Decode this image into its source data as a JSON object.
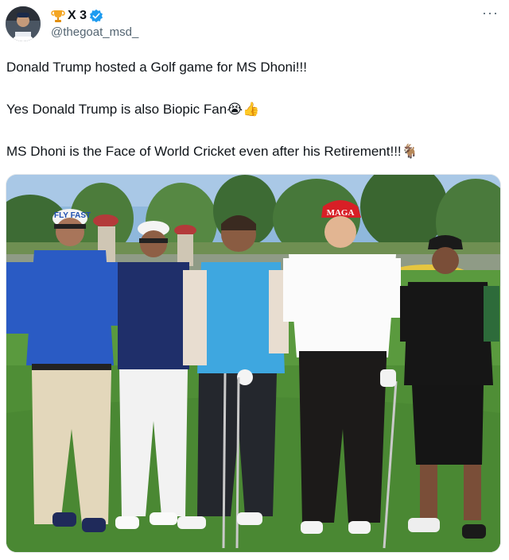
{
  "post": {
    "author": {
      "name_prefix_icon": "trophy-icon",
      "name": "X 3",
      "handle": "@thegoat_msd_",
      "verified_color": "#1d9bf0",
      "avatar_icon": "person-avatar"
    },
    "more_icon": "ellipsis-icon",
    "lines": [
      {
        "text": "Donald Trump hosted a Golf game for MS Dhoni!!!",
        "emoji": ""
      },
      {
        "text": "Yes Donald Trump is also Biopic Fan",
        "emoji": "😭👍"
      },
      {
        "text": "MS Dhoni is the Face of World Cricket even after his Retirement!!!",
        "emoji": "🐐"
      }
    ],
    "media": {
      "cap_text_1": "FLY FAST",
      "cap_text_2": "MAGA",
      "description_icon": "photo-golf-group"
    }
  }
}
